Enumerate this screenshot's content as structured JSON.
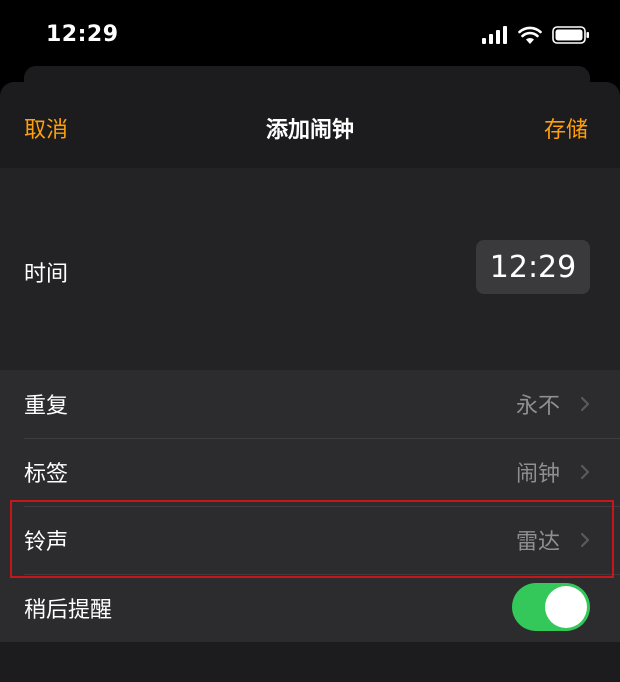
{
  "status_bar": {
    "time": "12:29"
  },
  "nav": {
    "cancel": "取消",
    "title": "添加闹钟",
    "save": "存储"
  },
  "time_row": {
    "label": "时间",
    "value": "12:29"
  },
  "rows": [
    {
      "label": "重复",
      "value": "永不"
    },
    {
      "label": "标签",
      "value": "闹钟"
    },
    {
      "label": "铃声",
      "value": "雷达"
    }
  ],
  "snooze": {
    "label": "稍后提醒",
    "enabled": true
  },
  "colors": {
    "accent": "#ff9f0a",
    "toggle_on": "#34c759",
    "highlight": "#c4171c"
  },
  "icons": [
    "signal-icon",
    "wifi-icon",
    "battery-icon",
    "chevron-right-icon"
  ]
}
